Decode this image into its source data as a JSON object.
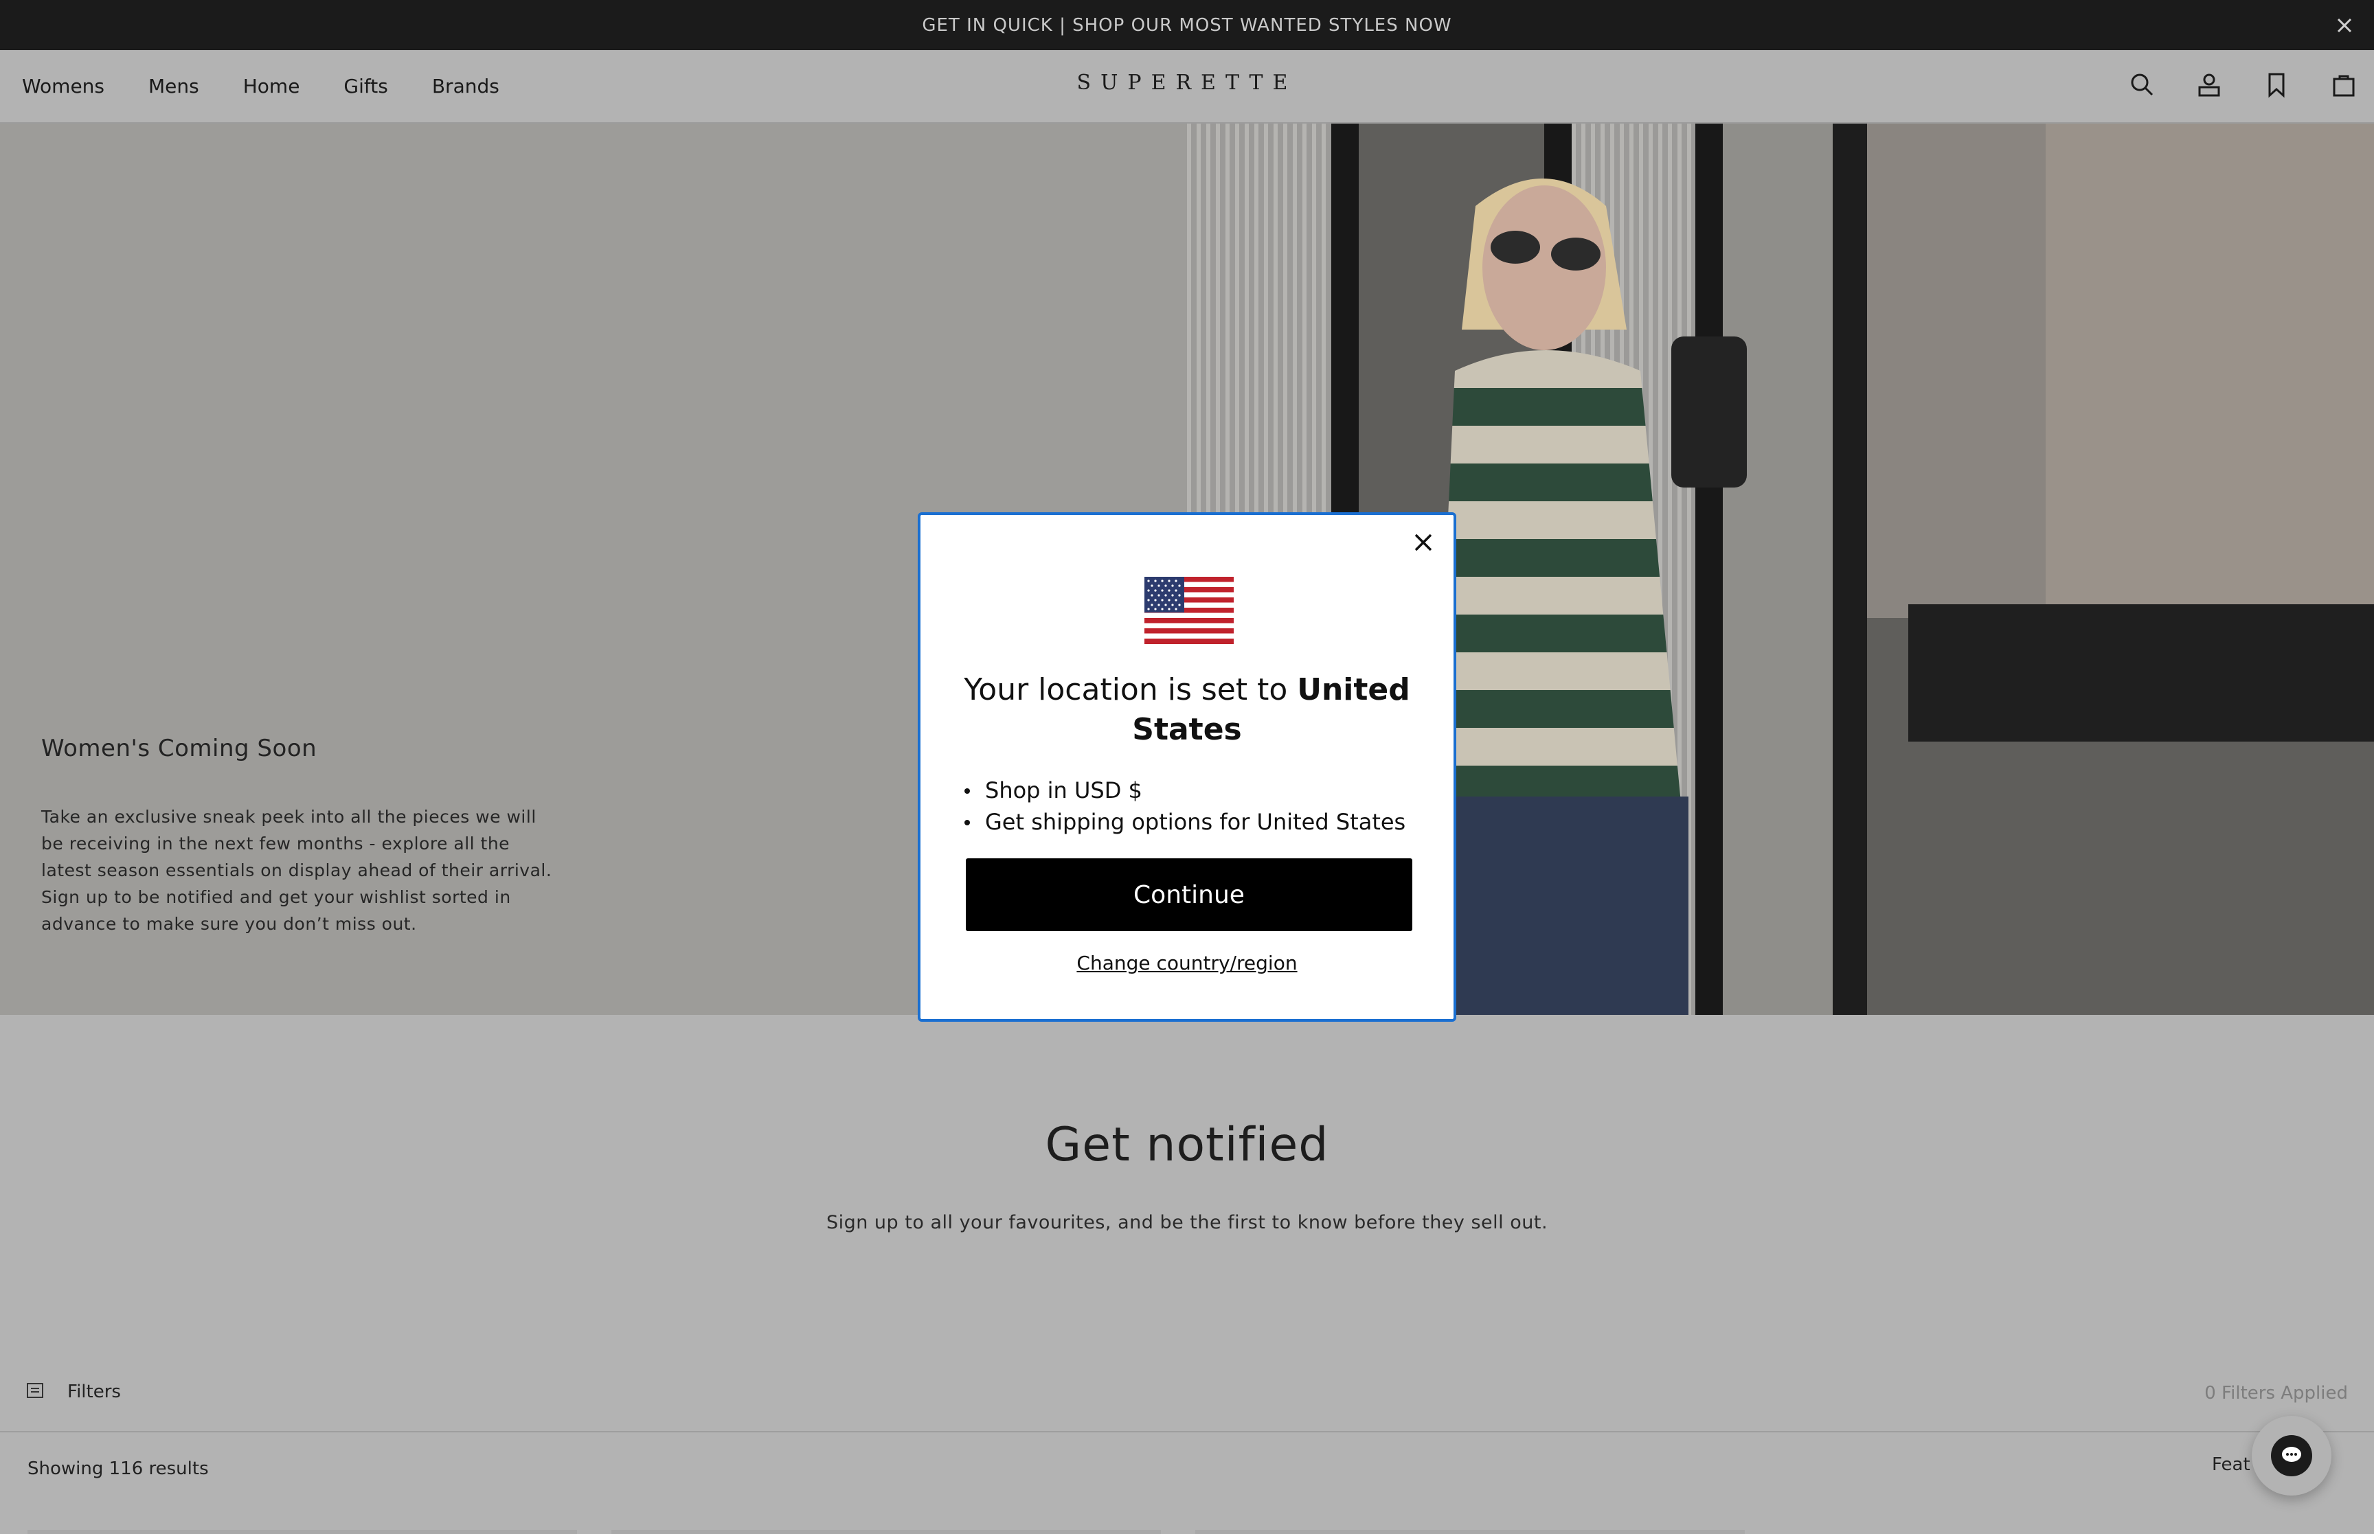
{
  "announcement": {
    "text": "GET IN QUICK | SHOP OUR MOST WANTED STYLES NOW",
    "close_icon": "close-icon"
  },
  "header": {
    "nav": [
      "Womens",
      "Mens",
      "Home",
      "Gifts",
      "Brands"
    ],
    "logo": "SUPERETTE",
    "icons": [
      "search-icon",
      "account-icon",
      "wishlist-icon",
      "bag-icon"
    ]
  },
  "hero": {
    "title": "Women's Coming Soon",
    "body": "Take an exclusive sneak peek into all the pieces we will be receiving in the next few months - explore all the latest season essentials on display ahead of their arrival. Sign up to be notified and get your wishlist sorted in advance to make sure you don’t miss out."
  },
  "notified": {
    "title": "Get notified",
    "subtitle": "Sign up to all your favourites, and be the first to know before they sell out."
  },
  "filters": {
    "label": "Filters",
    "applied": "0 Filters Applied"
  },
  "results": {
    "count_text": "Showing 116 results",
    "sort_label": "Feat"
  },
  "modal": {
    "title_prefix": "Your location is set to ",
    "country": "United States",
    "bullets": [
      "Shop in USD $",
      "Get shipping options for United States"
    ],
    "continue": "Continue",
    "change": "Change country/region"
  },
  "colors": {
    "overlay": "#b3b3b3",
    "announcement_bg": "#1b1b1b",
    "modal_border": "#1a6fd1",
    "button_bg": "#000000"
  }
}
